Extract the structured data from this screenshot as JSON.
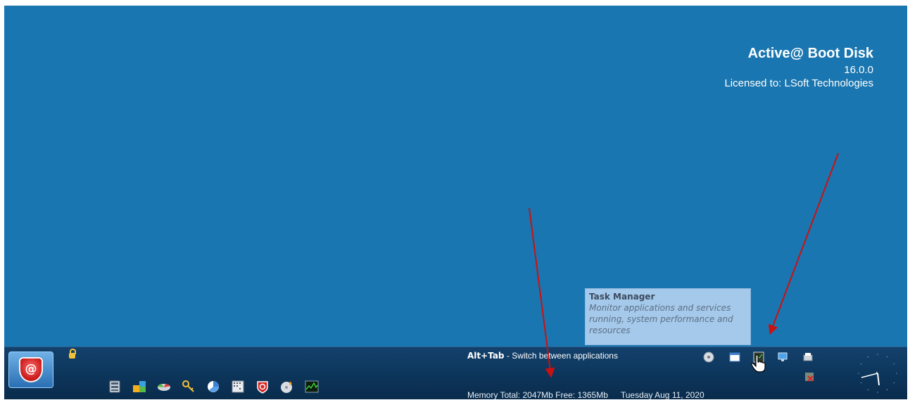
{
  "desktop": {
    "background_color": "#1a76b0",
    "product_title": "Active@ Boot Disk",
    "version": "16.0.0",
    "license": "Licensed to: LSoft Technologies"
  },
  "tooltip": {
    "title": "Task Manager",
    "description_lines": [
      "Monitor applications and services",
      "running, system performance and",
      "resources"
    ]
  },
  "taskbar": {
    "start_button_label": "@",
    "alt_tab_key": "Alt+Tab",
    "alt_tab_text": " - Switch between applications",
    "memory": "Memory Total: 2047Mb Free: 1365Mb",
    "date": "Tuesday  Aug 11, 2020",
    "quick_launch_icons": [
      "file-manager-icon",
      "partition-manager-icon",
      "disk-image-icon",
      "password-reset-icon",
      "disk-monitor-icon",
      "hex-editor-icon",
      "active-boot-disk-icon",
      "disk-burner-icon",
      "system-monitor-icon"
    ],
    "tray_icons": [
      "power-icon",
      "window-icon",
      "task-manager-icon",
      "network-icon",
      "printer-icon",
      "network-disconnected-icon"
    ]
  },
  "colors": {
    "accent": "#1a76b0",
    "taskbar": "#0c3459",
    "arrow": "#cc1010"
  }
}
